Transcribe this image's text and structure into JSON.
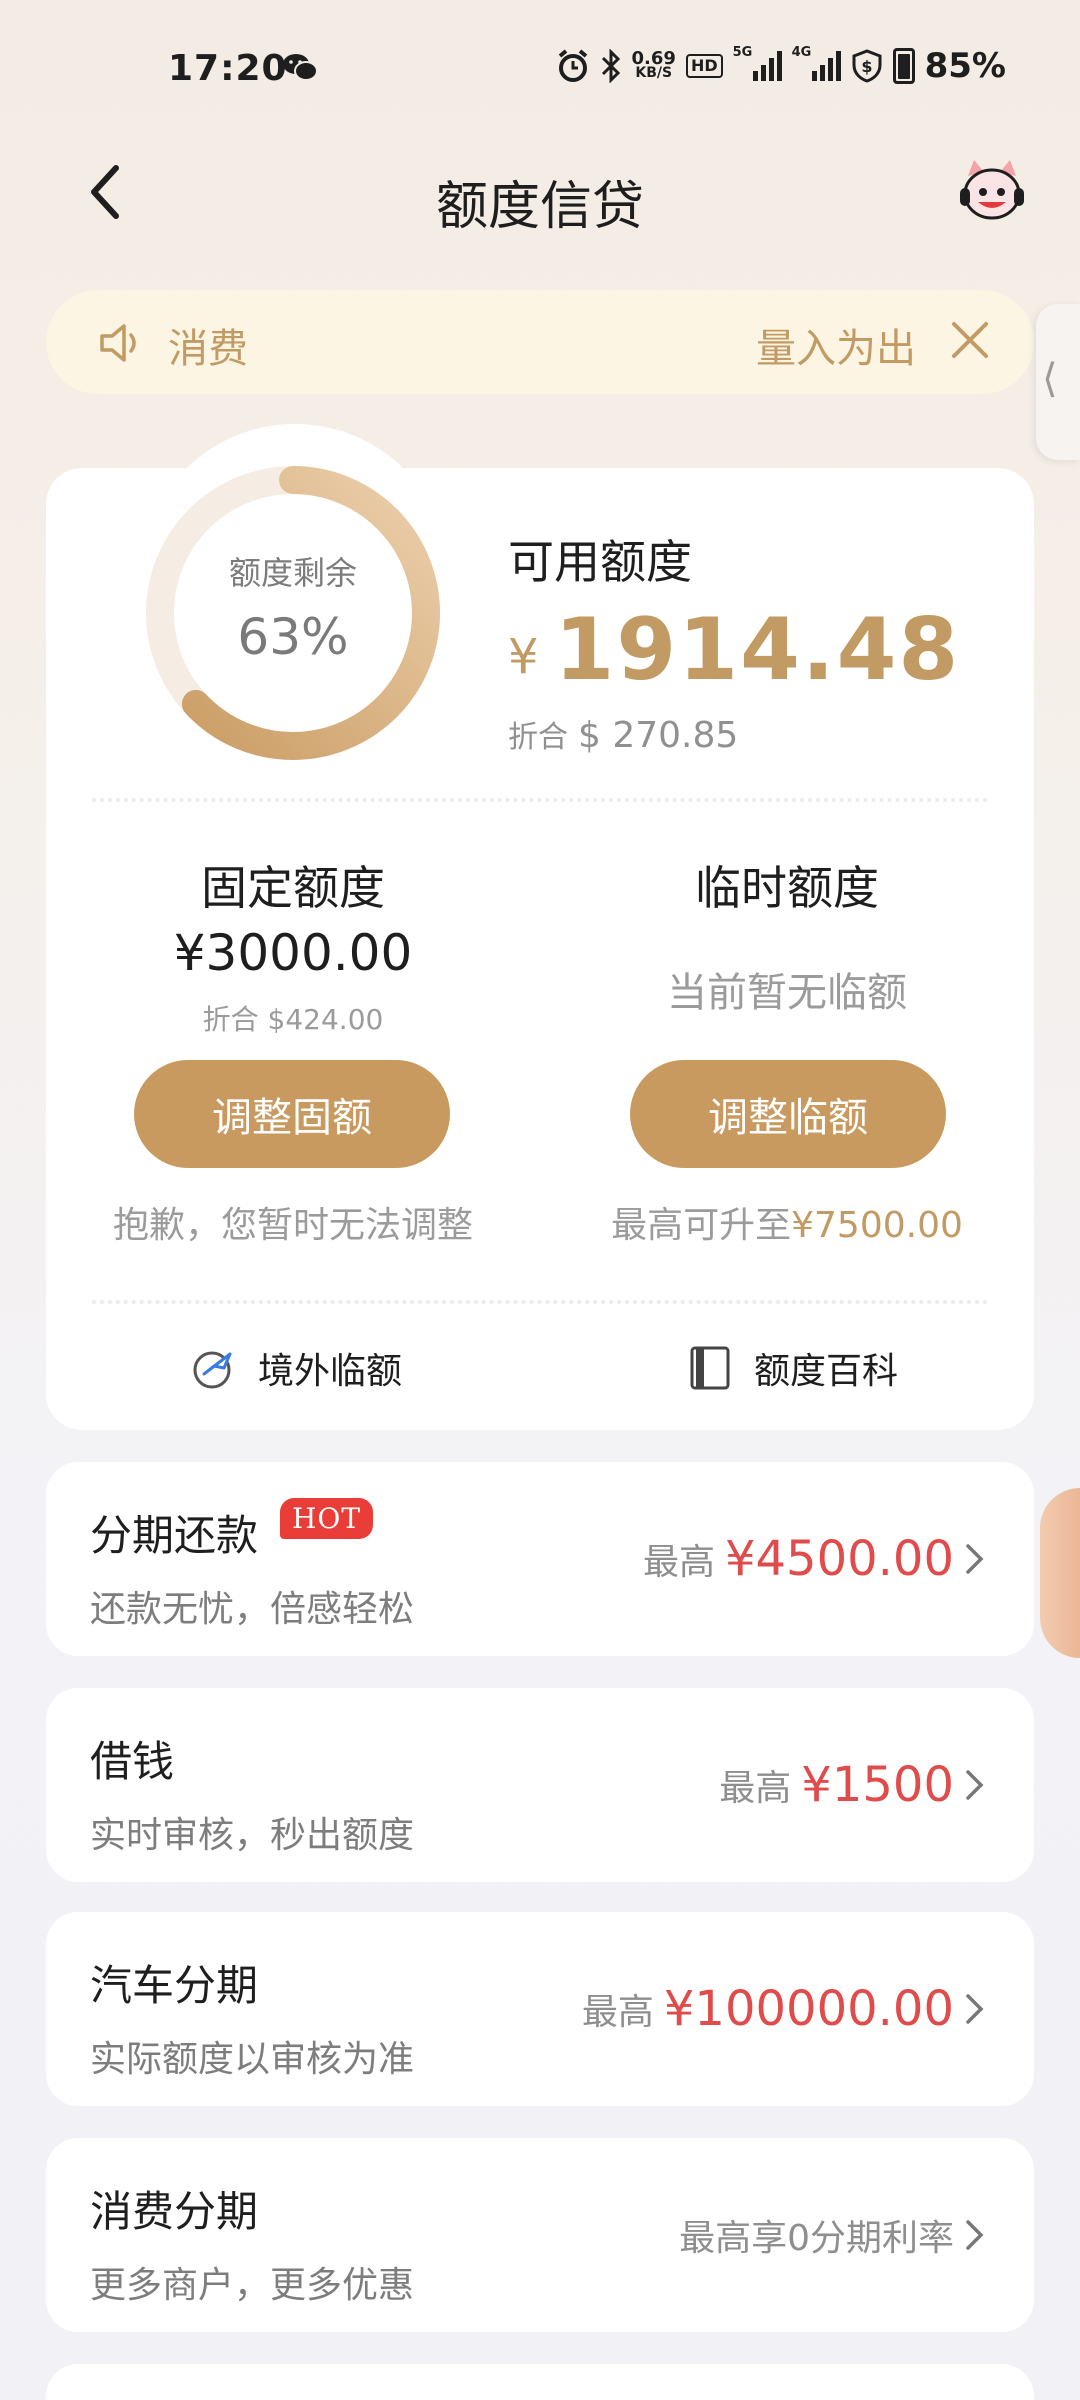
{
  "status_bar": {
    "time": "17:20",
    "speed_value": "0.69",
    "speed_unit": "KB/S",
    "hd_label": "HD",
    "net1": "5G",
    "net2": "4G",
    "battery": "85%",
    "icons": [
      "wechat-icon",
      "alarm-icon",
      "bluetooth-icon",
      "signal-icon",
      "shield-icon",
      "battery-icon"
    ]
  },
  "nav": {
    "title": "额度信贷"
  },
  "notice": {
    "left_text": "消费",
    "right_text": "量入为出",
    "side_tab_glyph": "⟨"
  },
  "credit": {
    "ring_label": "额度剩余",
    "ring_percent": "63%",
    "ring_fraction": 0.63,
    "available_label": "可用额度",
    "currency_symbol": "¥",
    "available_amount": "1914.48",
    "conv_prefix": "折合",
    "conv_amount": "$ 270.85"
  },
  "fixed": {
    "title": "固定额度",
    "amount": "¥3000.00",
    "conv": "折合 $424.00",
    "button": "调整固额",
    "note": "抱歉，您暂时无法调整"
  },
  "temp": {
    "title": "临时额度",
    "status": "当前暂无临额",
    "button": "调整临额",
    "note_prefix": "最高可升至",
    "note_amount": "¥7500.00"
  },
  "links": {
    "overseas": "境外临额",
    "wiki": "额度百科"
  },
  "products": [
    {
      "title": "分期还款",
      "badge": "HOT",
      "sub": "还款无忧，倍感轻松",
      "prefix": "最高",
      "value": "¥4500.00"
    },
    {
      "title": "借钱",
      "sub": "实时审核，秒出额度",
      "prefix": "最高",
      "value": "¥1500"
    },
    {
      "title": "汽车分期",
      "sub": "实际额度以审核为准",
      "prefix": "最高",
      "value": "¥100000.00"
    },
    {
      "title": "消费分期",
      "sub": "更多商户，更多优惠",
      "plain": "最高享0分期利率"
    }
  ],
  "colors": {
    "gold": "#c29a63",
    "button_gold": "#c99a60",
    "red": "#e04b4b",
    "notice_bg": "#fcf5e3"
  }
}
